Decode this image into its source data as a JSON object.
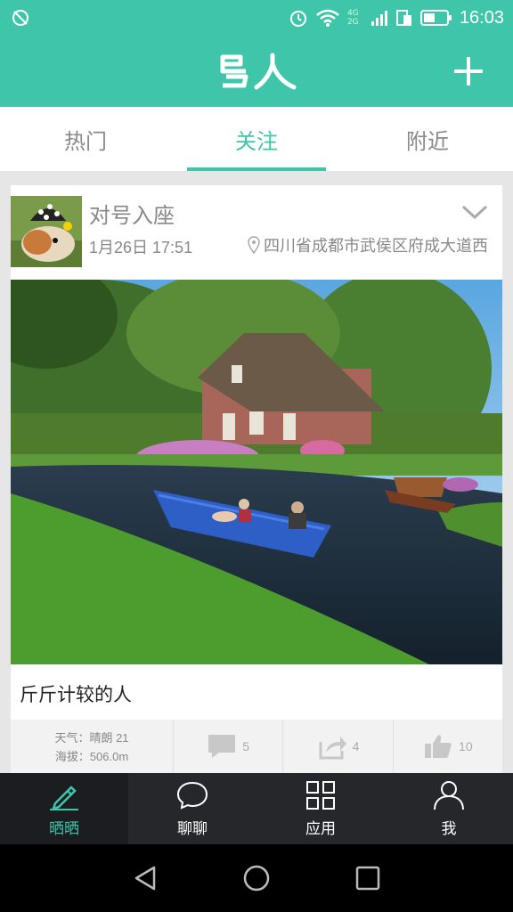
{
  "status_bar": {
    "time": "16:03",
    "network": "4G 2G",
    "icons": [
      "gps-off-icon",
      "alarm-icon",
      "wifi-icon",
      "signal-icon",
      "sim-icon",
      "battery-icon"
    ]
  },
  "header": {
    "logo_text": "鸟人",
    "add_icon": "plus-icon"
  },
  "tabs": [
    {
      "label": "热门",
      "active": false
    },
    {
      "label": "关注",
      "active": true
    },
    {
      "label": "附近",
      "active": false
    }
  ],
  "post": {
    "author": "对号入座",
    "date": "1月26日 17:51",
    "location": "四川省成都市武侯区府成大道西",
    "caption": "斤斤计较的人",
    "weather_line1": "天气：晴朗  21",
    "weather_line2": "海拔：506.0m",
    "comments": "5",
    "shares": "4",
    "likes": "10"
  },
  "bottom_nav": [
    {
      "label": "晒晒",
      "icon": "pencil-icon",
      "active": true
    },
    {
      "label": "聊聊",
      "icon": "chat-bubble-icon",
      "active": false
    },
    {
      "label": "应用",
      "icon": "grid-icon",
      "active": false
    },
    {
      "label": "我",
      "icon": "person-icon",
      "active": false
    }
  ],
  "colors": {
    "accent": "#3fc6aa",
    "nav_bg": "#26272b"
  }
}
